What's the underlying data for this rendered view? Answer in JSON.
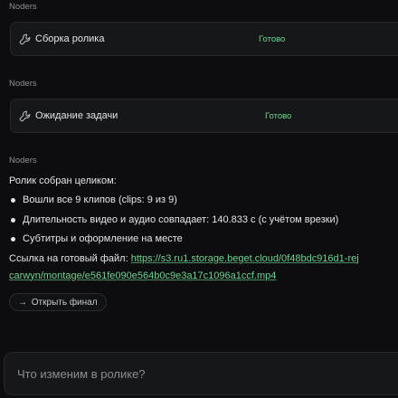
{
  "tasks": [
    {
      "agent": "Noders",
      "icon": "wrench-icon",
      "title": "Сборка ролика",
      "status": "Готово"
    },
    {
      "agent": "Noders",
      "icon": "wrench-icon",
      "title": "Ожидание задачи",
      "status": "Готово"
    }
  ],
  "message": {
    "agent": "Noders",
    "intro": "Ролик собран целиком:",
    "bullets": [
      "Вошли все 9 клипов (clips: 9 из 9)",
      "Длительность видео и аудио совпадает: 140.833 с (с учётом врезки)",
      "Субтитры и оформление на месте"
    ],
    "link_prefix": "Ссылка на готовый файл: ",
    "link_line1": "https://s3.ru1.storage.beget.cloud/0f48bdc916d1-rej",
    "link_line2": "carwyn/montage/e561fe090e564b0c9e3a17c1096a1ccf.mp4",
    "open_button": {
      "arrow": "→",
      "label": "Открыть финал"
    }
  },
  "composer": {
    "placeholder": "Что изменим в ролике?"
  },
  "colors": {
    "background": "#0d0d0f",
    "card": "#161719",
    "accent_green": "#6fd48f",
    "muted": "#8d8f96"
  }
}
